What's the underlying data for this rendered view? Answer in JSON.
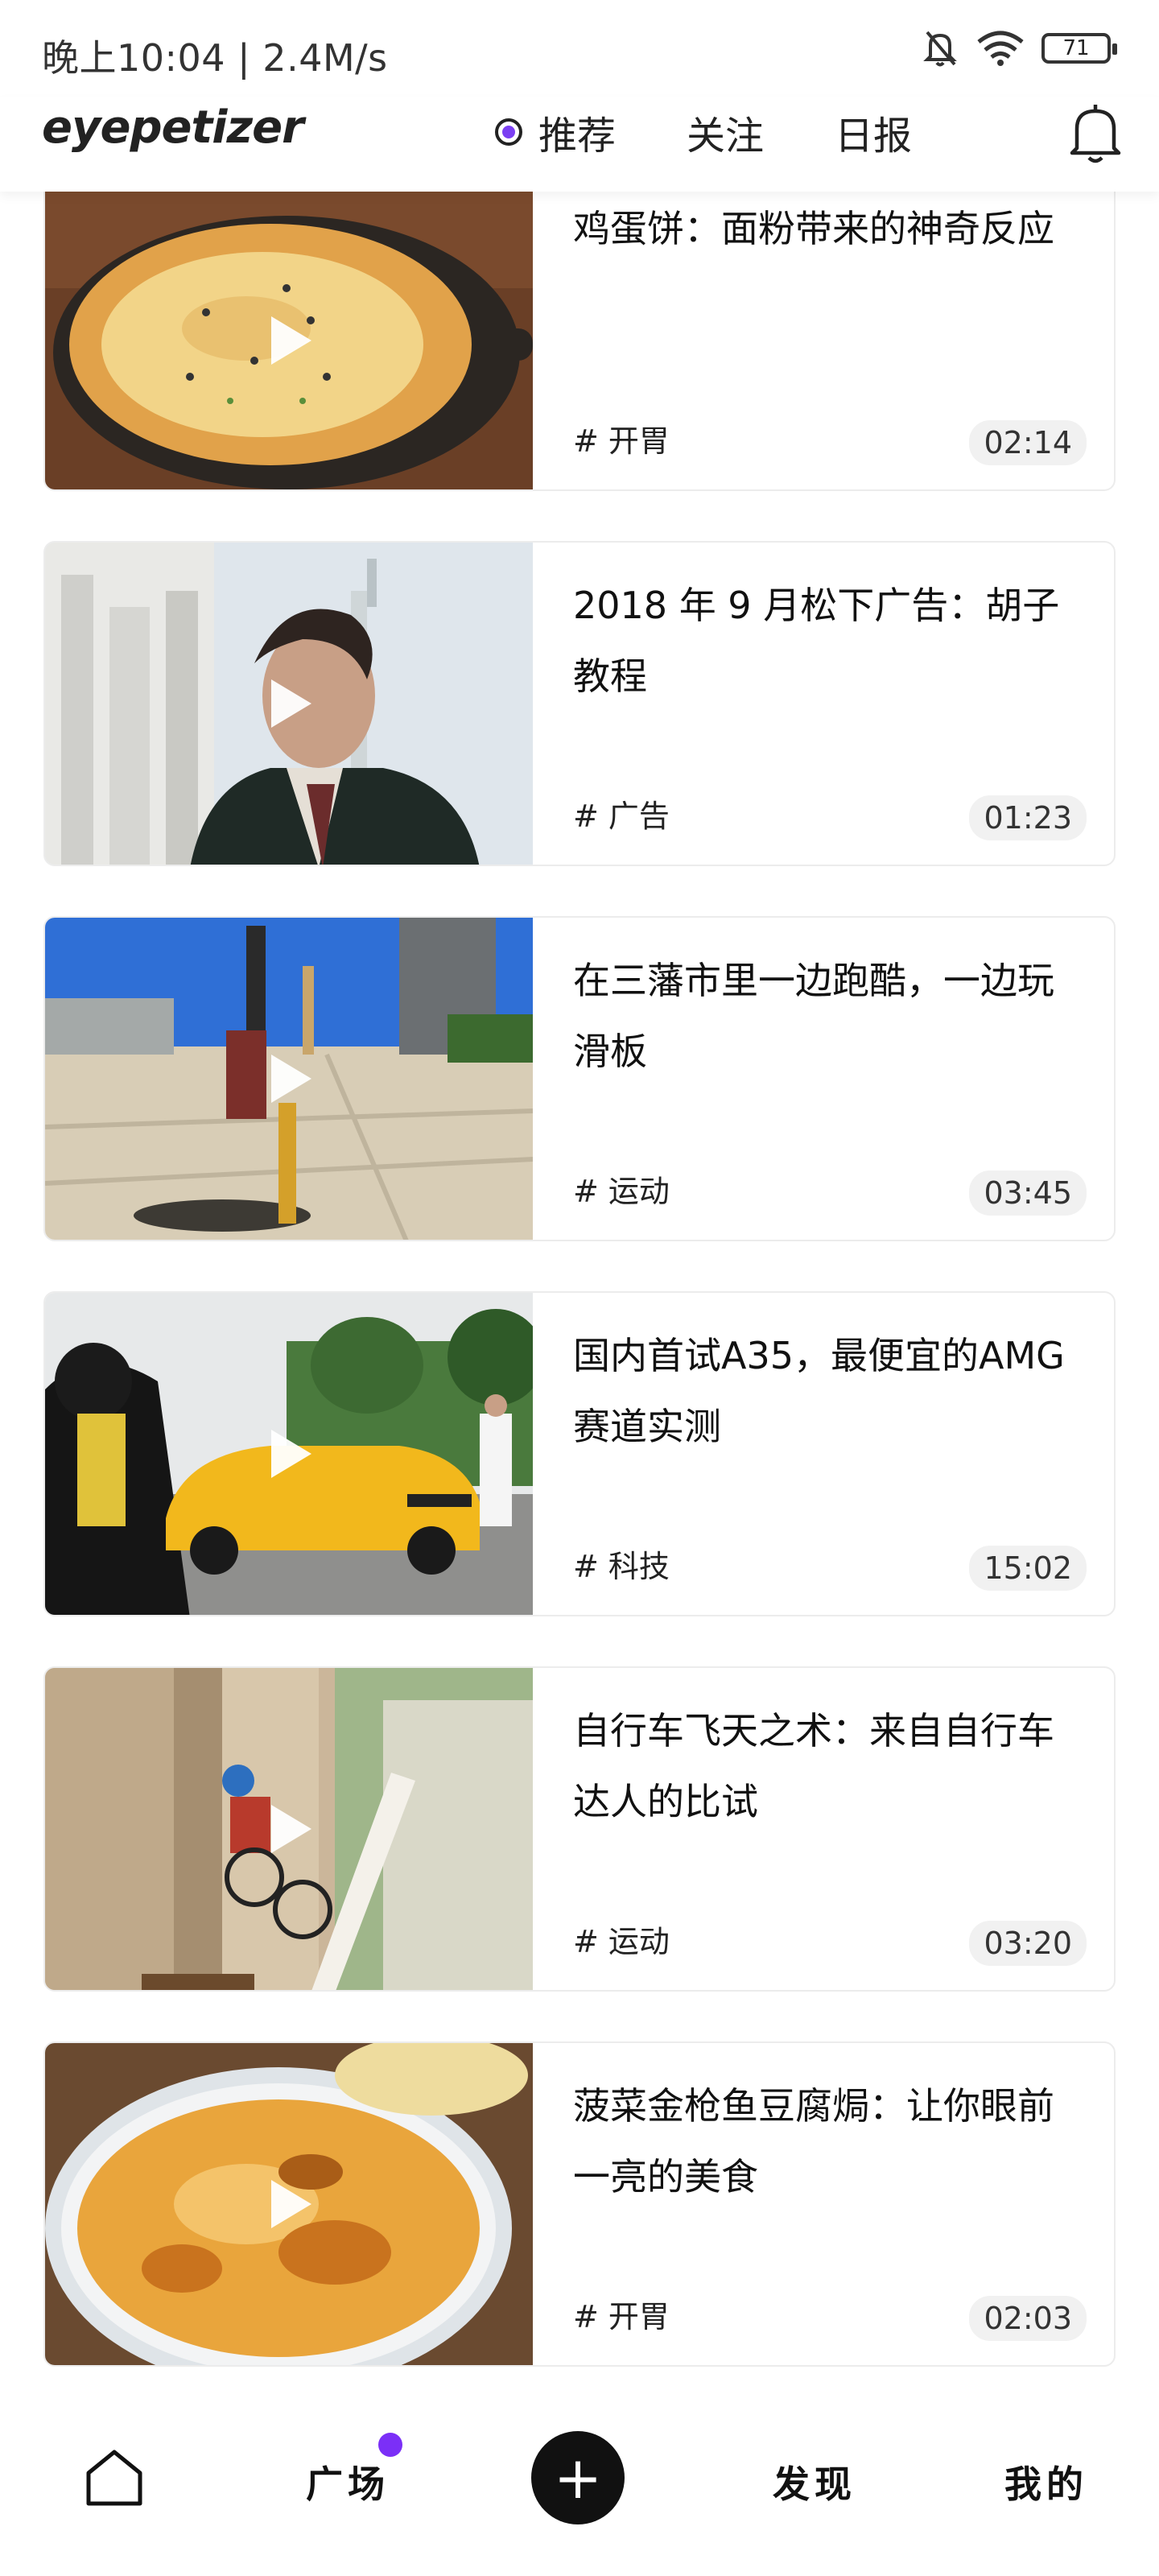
{
  "status": {
    "time_speed": "晚上10:04 | 2.4M/s",
    "battery": "71"
  },
  "header": {
    "logo": "eyepetizer",
    "tabs": [
      {
        "label": "推荐"
      },
      {
        "label": "关注"
      },
      {
        "label": "日报"
      }
    ]
  },
  "feed": [
    {
      "title": "鸡蛋饼：面粉带来的神奇反应",
      "tag": "# 开胃",
      "duration": "02:14"
    },
    {
      "title": "2018 年 9 月松下广告：胡子教程",
      "tag": "# 广告",
      "duration": "01:23"
    },
    {
      "title": "在三藩市里一边跑酷，一边玩滑板",
      "tag": "# 运动",
      "duration": "03:45"
    },
    {
      "title": "国内首试A35，最便宜的AMG赛道实测",
      "tag": "# 科技",
      "duration": "15:02"
    },
    {
      "title": "自行车飞天之术：来自自行车达人的比试",
      "tag": "# 运动",
      "duration": "03:20"
    },
    {
      "title": "菠菜金枪鱼豆腐焗：让你眼前一亮的美食",
      "tag": "# 开胃",
      "duration": "02:03"
    }
  ],
  "bottom_nav": {
    "square": "广场",
    "plus": "+",
    "discover": "发现",
    "mine": "我的"
  },
  "colors": {
    "accent": "#7b2ff7"
  }
}
